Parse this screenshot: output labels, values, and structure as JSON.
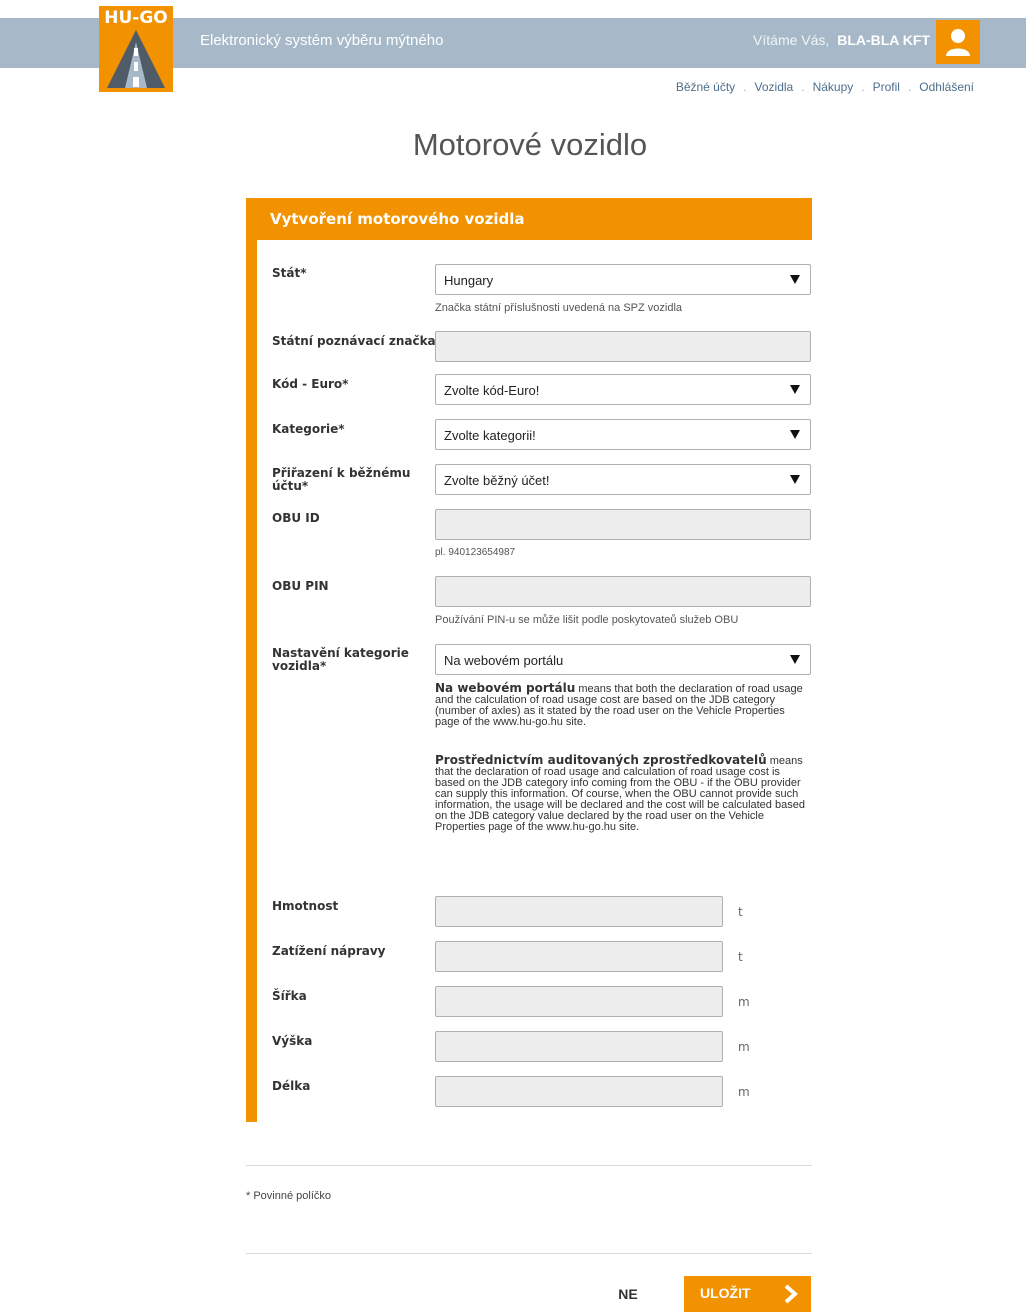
{
  "header": {
    "logo_text": "HU-GO",
    "app_title": "Elektronický systém výběru mýtného",
    "welcome": "Vítáme Vás,",
    "company": "BLA-BLA KFT",
    "nav": [
      "Běžné účty",
      "Vozidla",
      "Nákupy",
      "Profil",
      "Odhlášení"
    ],
    "nav_separator": "."
  },
  "page": {
    "title": "Motorové vozidlo"
  },
  "form": {
    "section_title": "Vytvoření motorového vozidla",
    "country": {
      "label": "Stát*",
      "value": "Hungary",
      "hint": "Značka státní příslušnosti uvedená na SPZ vozidla"
    },
    "plate": {
      "label": "Státní poznávací značka*",
      "value": ""
    },
    "euro_code": {
      "label": "Kód - Euro*",
      "value": "Zvolte kód-Euro!"
    },
    "category": {
      "label": "Kategorie*",
      "value": "Zvolte kategorii!"
    },
    "account": {
      "label_line1": "Přiřazení k běžnému",
      "label_line2": "účtu*",
      "value": "Zvolte běžný účet!"
    },
    "obu_id": {
      "label": "OBU ID",
      "value": "",
      "hint": "pl. 940123654987"
    },
    "obu_pin": {
      "label": "OBU PIN",
      "value": "",
      "hint": "Používání PIN-u se může lišit podle poskytovateů služeb OBU"
    },
    "category_setting": {
      "label_line1": "Nastavění kategorie",
      "label_line2": "vozidla*",
      "value": "Na webovém portálu",
      "desc1_bold": "Na webovém portálu",
      "desc1_text": "means that both the declaration of road usage and the calculation of road usage cost are based on the JDB category (number of axles) as it stated by the road user on the Vehicle Properties page of the www.hu-go.hu site.",
      "desc2_bold": "Prostřednictvím auditovaných zprostředkovatelů",
      "desc2_text": "means that the declaration of road usage and calculation of road usage cost is based on the JDB category info coming from the OBU - if the OBU provider can supply this information. Of course, when the OBU cannot provide such information, the usage will be declared and the cost will be calculated based on the JDB category value declared by the road user on the Vehicle Properties page of the www.hu-go.hu site."
    },
    "weight": {
      "label": "Hmotnost",
      "unit": "t"
    },
    "axle_load": {
      "label": "Zatížení nápravy",
      "unit": "t"
    },
    "width": {
      "label": "Šířka",
      "unit": "m"
    },
    "height": {
      "label": "Výška",
      "unit": "m"
    },
    "length": {
      "label": "Délka",
      "unit": "m"
    }
  },
  "footnote": "* Povinné políčko",
  "actions": {
    "cancel_label": "NE",
    "save_label": "ULOŽIT"
  },
  "colors": {
    "accent": "#f39200",
    "header_bg": "#a7b9c9",
    "nav_link": "#4d6f8e"
  },
  "icons": {
    "logo": "road-icon",
    "user": "user-icon",
    "save": "chevron-right-icon",
    "select": "triangle-down-icon"
  }
}
